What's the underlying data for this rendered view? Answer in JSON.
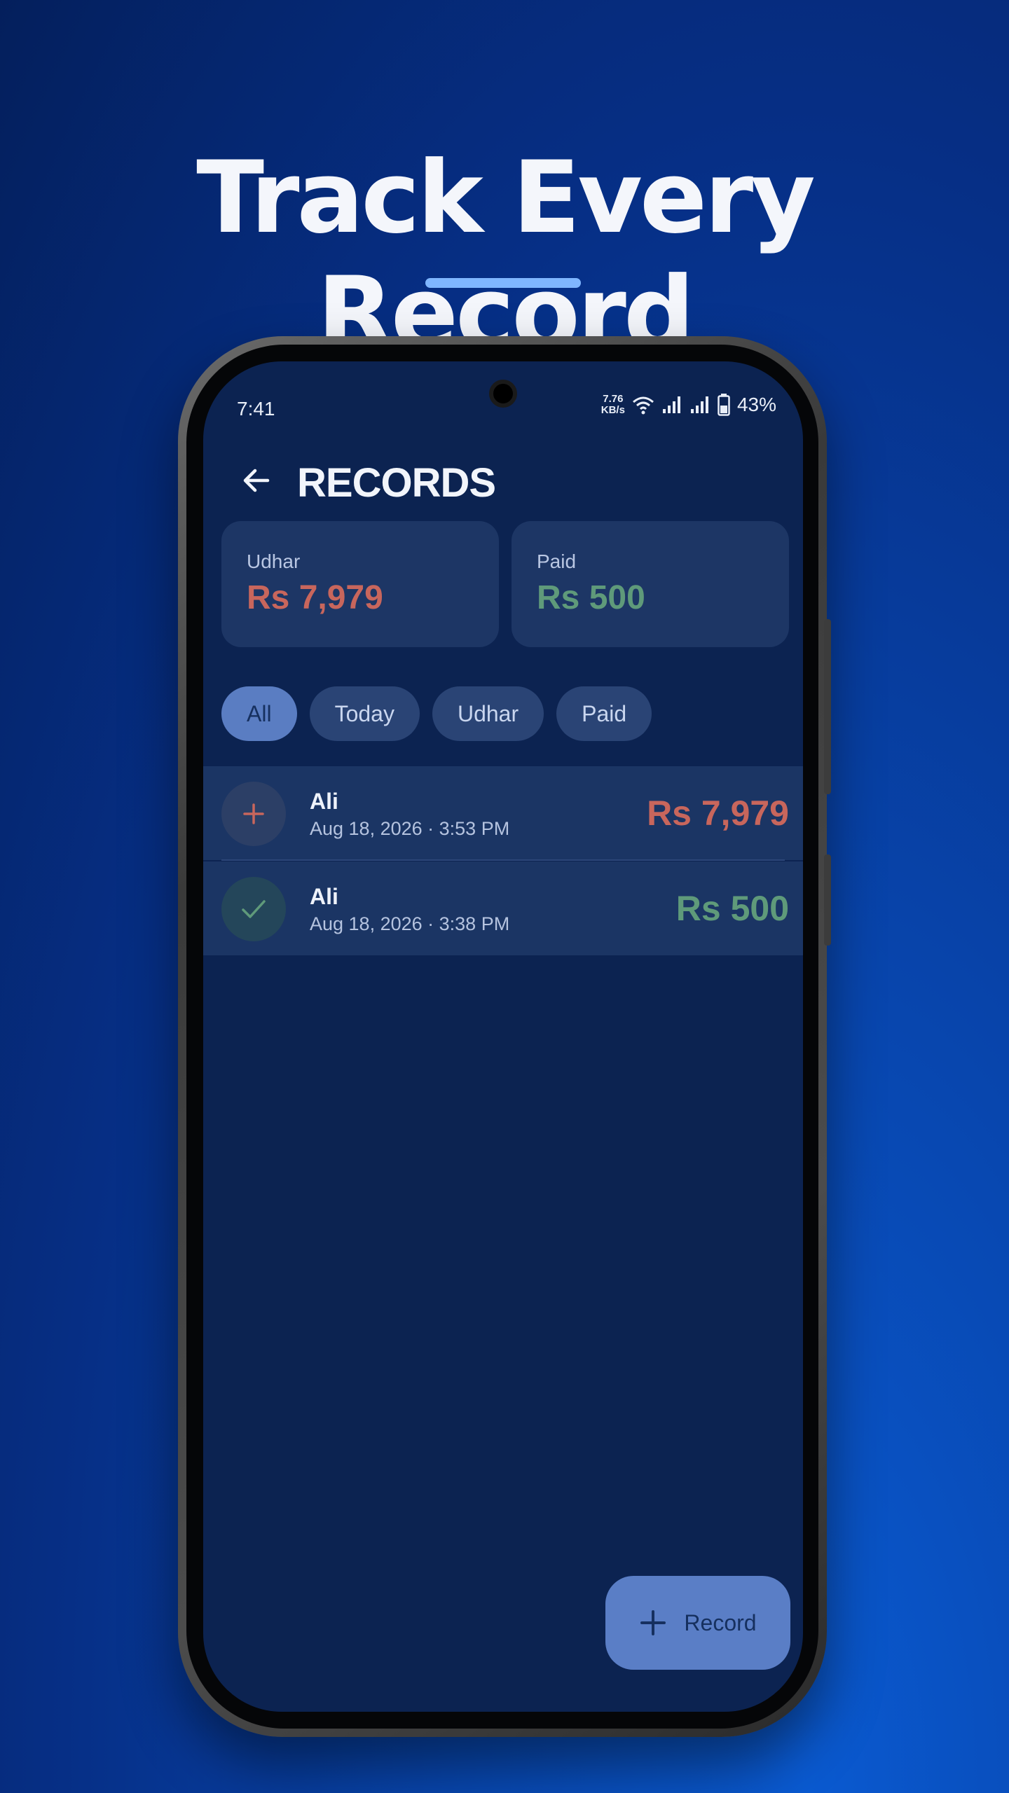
{
  "headline": "Track Every Record",
  "status_bar": {
    "time": "7:41",
    "net_speed_value": "7.76",
    "net_speed_unit": "KB/s",
    "battery": "43%",
    "icons": [
      "wifi-icon",
      "signal-icon",
      "signal-icon",
      "battery-icon"
    ]
  },
  "app_bar": {
    "back_icon": "arrow-left-icon",
    "title": "RECORDS"
  },
  "summary": {
    "udhar_label": "Udhar",
    "udhar_value": "Rs 7,979",
    "paid_label": "Paid",
    "paid_value": "Rs 500"
  },
  "filters": [
    "All",
    "Today",
    "Udhar",
    "Paid"
  ],
  "selected_filter": "All",
  "records": [
    {
      "name": "Ali",
      "date": "Aug 18, 2026 · 3:53 PM",
      "amount": "Rs 7,979",
      "type": "udhar",
      "icon": "plus-icon"
    },
    {
      "name": "Ali",
      "date": "Aug 18, 2026 · 3:38 PM",
      "amount": "Rs 500",
      "type": "paid",
      "icon": "check-icon"
    }
  ],
  "fab": {
    "label": "Record",
    "icon": "plus-icon"
  },
  "colors": {
    "udhar": "#c8665c",
    "paid": "#5f9a7a",
    "accent": "#7fb6ff"
  }
}
